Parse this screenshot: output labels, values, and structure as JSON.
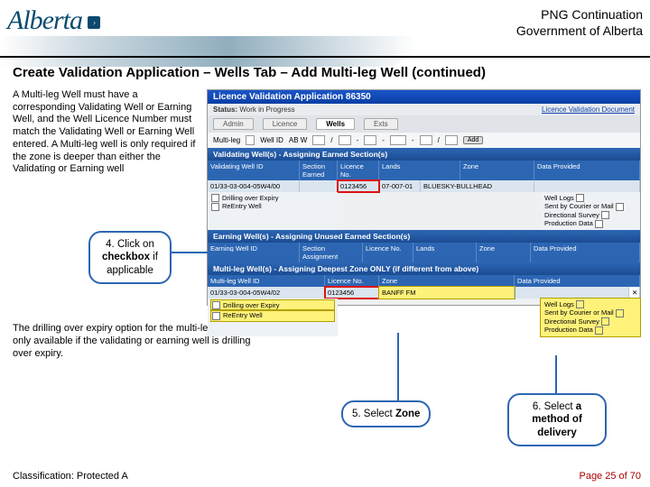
{
  "header": {
    "title_line1": "PNG Continuation",
    "title_line2": "Government of Alberta",
    "logo_text": "Alberta"
  },
  "section_title": "Create Validation Application – Wells Tab – Add Multi-leg Well (continued)",
  "para1": "A Multi-leg Well must have a corresponding Validating Well or Earning Well, and the Well Licence Number must match the Validating Well or Earning Well entered.  A Multi-leg well is only required if the zone is deeper than either the Validating or Earning well",
  "para2": "The drilling over expiry option for the multi-leg well is only available if the validating or earning well is drilling over expiry.",
  "app": {
    "title": "Licence Validation Application 86350",
    "status_label": "Status:",
    "status_value": "Work in Progress",
    "doc_link": "Licence Validation Document",
    "tabs": [
      "Admin",
      "Licence",
      "Wells",
      "Exts"
    ],
    "active_tab": 2,
    "filter": {
      "multileg_label": "Multi-leg",
      "wellid_label": "Well ID",
      "ab": "AB W",
      "add_btn": "Add"
    },
    "validating": {
      "header": "Validating Well(s) - Assigning Earned Section(s)",
      "cols": [
        "Validating Well ID",
        "Section Earned",
        "Licence No.",
        "Lands",
        "Zone",
        "Data Provided"
      ],
      "row": {
        "id": "01/33-03-004-05W4/00",
        "licence": "0123456",
        "landinfo": "07-007-01",
        "lands": "BLUESKY-BULLHEAD"
      },
      "opts": [
        "Drilling over Expiry",
        "ReEntry Well"
      ],
      "data_opts": [
        "Well Logs",
        "Sent by Courier or Mail",
        "Directional Survey",
        "Production Data"
      ]
    },
    "earning": {
      "header": "Earning Well(s) - Assigning Unused Earned Section(s)",
      "cols": [
        "Earning Well ID",
        "Section Assignment",
        "Licence No.",
        "Lands",
        "Zone",
        "Data Provided"
      ]
    },
    "multileg": {
      "header": "Multi-leg Well(s) - Assigning Deepest Zone ONLY (if different from above)",
      "cols": [
        "Multi-leg Well ID",
        "Licence No.",
        "Zone",
        "Data Provided"
      ],
      "row": {
        "id": "01/33-03-004-05W4/02",
        "licence": "0123456",
        "zone": "BANFF FM"
      },
      "opts": [
        "Drilling over Expiry",
        "ReEntry Well"
      ],
      "data_opts": [
        "Well Logs",
        "Sent by Courier or Mail",
        "Directional Survey",
        "Production Data"
      ]
    }
  },
  "callouts": {
    "c4a": "4. Click on",
    "c4b": "checkbox",
    "c4c": " if applicable",
    "c5a": "5. Select ",
    "c5b": "Zone",
    "c6a": "6. Select ",
    "c6b": "a method of delivery"
  },
  "footer": {
    "classification": "Classification: Protected A",
    "page": "Page 25 of 70"
  }
}
